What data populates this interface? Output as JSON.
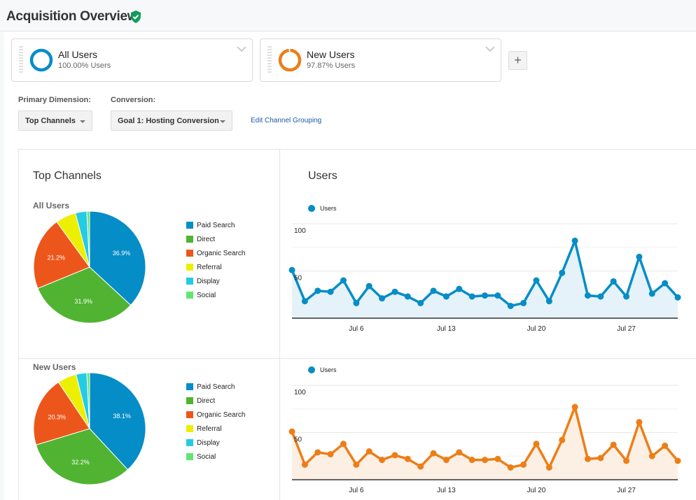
{
  "header": {
    "title": "Acquisition Overview",
    "verified_icon": "shield-check-icon",
    "verified_color": "#0f9d58"
  },
  "segments": [
    {
      "name": "All Users",
      "subtitle": "100.00% Users",
      "color": "#058dc7",
      "fraction": 1.0
    },
    {
      "name": "New Users",
      "subtitle": "97.87% Users",
      "color": "#ed7e17",
      "fraction": 0.9787
    }
  ],
  "add_segment_label": "+",
  "controls": {
    "primary_dimension_label": "Primary Dimension:",
    "primary_dimension_value": "Top Channels",
    "conversion_label": "Conversion:",
    "conversion_value": "Goal 1: Hosting Conversion",
    "edit_link": "Edit Channel Grouping"
  },
  "sections": {
    "left_title": "Top Channels",
    "right_title": "Users"
  },
  "chart_data": [
    {
      "type": "pie",
      "title": "All Users",
      "categories": [
        "Paid Search",
        "Direct",
        "Organic Search",
        "Referral",
        "Display",
        "Social"
      ],
      "values": [
        36.9,
        31.9,
        21.2,
        5.9,
        3.3,
        0.8
      ],
      "labels": [
        "36.9%",
        "31.9%",
        "21.2%",
        "",
        "",
        ""
      ],
      "colors": [
        "#058dc7",
        "#50b432",
        "#ed561b",
        "#edef00",
        "#24cbe5",
        "#64e572"
      ],
      "legend": "right"
    },
    {
      "type": "pie",
      "title": "New Users",
      "categories": [
        "Paid Search",
        "Direct",
        "Organic Search",
        "Referral",
        "Display",
        "Social"
      ],
      "values": [
        38.1,
        32.2,
        20.3,
        5.5,
        3.1,
        0.8
      ],
      "labels": [
        "38.1%",
        "32.2%",
        "20.3%",
        "",
        "",
        ""
      ],
      "colors": [
        "#058dc7",
        "#50b432",
        "#ed561b",
        "#edef00",
        "#24cbe5",
        "#64e572"
      ],
      "legend": "right"
    },
    {
      "type": "area",
      "title": "",
      "series": [
        {
          "name": "Users",
          "color": "#058dc7",
          "values": [
            51,
            18,
            29,
            28,
            40,
            16,
            34,
            21,
            28,
            23,
            16,
            29,
            23,
            31,
            23,
            24,
            24,
            13,
            16,
            40,
            18,
            48,
            82,
            24,
            23,
            39,
            23,
            65,
            26,
            37,
            22
          ]
        }
      ],
      "x": [
        "Jul 1",
        "Jul 2",
        "Jul 3",
        "Jul 4",
        "Jul 5",
        "Jul 6",
        "Jul 7",
        "Jul 8",
        "Jul 9",
        "Jul 10",
        "Jul 11",
        "Jul 12",
        "Jul 13",
        "Jul 14",
        "Jul 15",
        "Jul 16",
        "Jul 17",
        "Jul 18",
        "Jul 19",
        "Jul 20",
        "Jul 21",
        "Jul 22",
        "Jul 23",
        "Jul 24",
        "Jul 25",
        "Jul 26",
        "Jul 27",
        "Jul 28",
        "Jul 29",
        "Jul 30",
        "Jul 31"
      ],
      "xticks": [
        "Jul 6",
        "Jul 13",
        "Jul 20",
        "Jul 27"
      ],
      "yticks": [
        "100",
        "50"
      ],
      "ylim": [
        0,
        100
      ],
      "grid": true,
      "legend": "top-left"
    },
    {
      "type": "area",
      "title": "",
      "series": [
        {
          "name": "Users",
          "color": "#ed7e17",
          "legend_color": "#058dc7",
          "values": [
            51,
            16,
            29,
            27,
            38,
            16,
            30,
            21,
            26,
            22,
            14,
            28,
            21,
            29,
            21,
            21,
            22,
            13,
            16,
            38,
            13,
            42,
            77,
            22,
            23,
            37,
            20,
            61,
            25,
            36,
            20
          ]
        }
      ],
      "x": [
        "Jul 1",
        "Jul 2",
        "Jul 3",
        "Jul 4",
        "Jul 5",
        "Jul 6",
        "Jul 7",
        "Jul 8",
        "Jul 9",
        "Jul 10",
        "Jul 11",
        "Jul 12",
        "Jul 13",
        "Jul 14",
        "Jul 15",
        "Jul 16",
        "Jul 17",
        "Jul 18",
        "Jul 19",
        "Jul 20",
        "Jul 21",
        "Jul 22",
        "Jul 23",
        "Jul 24",
        "Jul 25",
        "Jul 26",
        "Jul 27",
        "Jul 28",
        "Jul 29",
        "Jul 30",
        "Jul 31"
      ],
      "xticks": [
        "Jul 6",
        "Jul 13",
        "Jul 20",
        "Jul 27"
      ],
      "yticks": [
        "100",
        "50"
      ],
      "ylim": [
        0,
        100
      ],
      "grid": true,
      "legend": "top-left"
    }
  ]
}
